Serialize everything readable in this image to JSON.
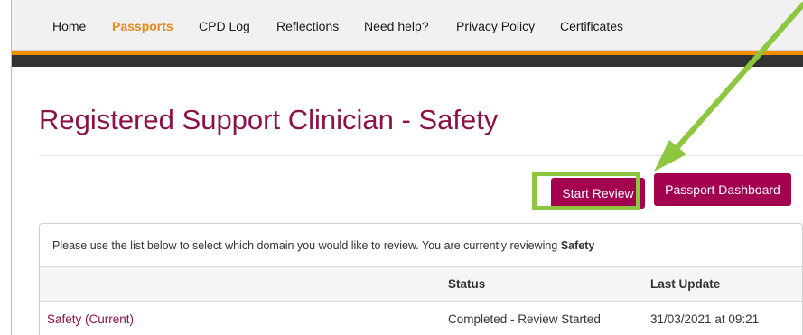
{
  "nav": {
    "items": [
      {
        "label": "Home"
      },
      {
        "label": "Passports"
      },
      {
        "label": "CPD Log"
      },
      {
        "label": "Reflections"
      },
      {
        "label": "Need help?"
      },
      {
        "label": "Privacy Policy"
      },
      {
        "label": "Certificates"
      }
    ],
    "active_index": 1
  },
  "page": {
    "title": "Registered Support Clinician - Safety"
  },
  "actions": {
    "start_review": "Start Review",
    "passport_dashboard": "Passport Dashboard"
  },
  "domain_panel": {
    "intro": "Please use the list below to select which domain you would like to review. You are currently reviewing ",
    "current_domain": "Safety",
    "columns": [
      "",
      "Status",
      "Last Update"
    ],
    "rows": [
      {
        "domain": "Safety (Current)",
        "status": "Completed - Review Started",
        "last_update": "31/03/2021 at 09:21"
      }
    ]
  },
  "colors": {
    "brand": "#a3004f",
    "title": "#8b1248",
    "nav_active": "#e7891b",
    "accent_bar": "#f28f00",
    "dark_bar": "#333333",
    "annotation": "#8dc63f"
  }
}
